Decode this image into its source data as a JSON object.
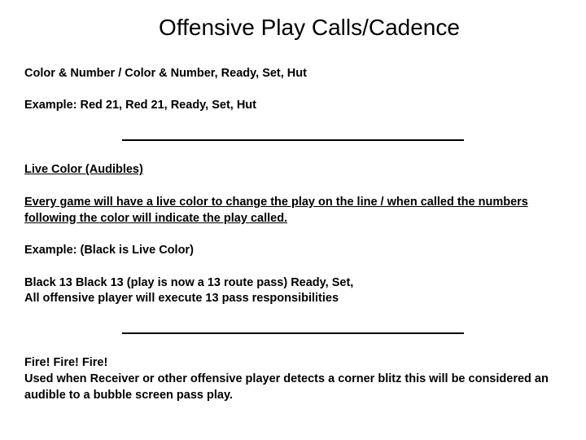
{
  "title": "Offensive Play Calls/Cadence",
  "line1": "Color & Number / Color & Number, Ready, Set, Hut",
  "line2": "Example:  Red 21, Red 21, Ready, Set, Hut",
  "heading1": "Live Color (Audibles)",
  "para1": "Every game will have a live color to change the play on the line / when called the numbers following the color will indicate the play called.",
  "line3": "Example:  (Black is Live Color)",
  "line4a": "Black 13 Black 13 (play is now a 13 route pass) Ready, Set,",
  "line4b": "All offensive player will execute 13 pass responsibilities",
  "line5a": "Fire! Fire! Fire!",
  "line5b": "Used when Receiver or other offensive player detects a corner blitz this will be considered an audible to a bubble screen pass play."
}
